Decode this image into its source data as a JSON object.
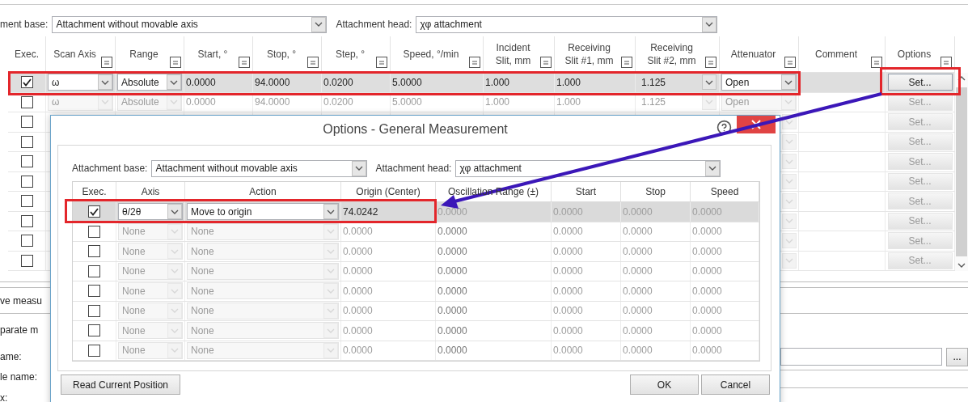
{
  "attachment": {
    "base_label": "ment base:",
    "base_value": "Attachment without movable axis",
    "head_label": "Attachment head:",
    "head_value": "χφ attachment"
  },
  "table": {
    "columns": [
      {
        "label": "Exec.",
        "filter": false
      },
      {
        "label": "Scan Axis",
        "filter": true
      },
      {
        "label": "Range",
        "filter": true
      },
      {
        "label": "Start, °",
        "filter": true
      },
      {
        "label": "Stop, °",
        "filter": true
      },
      {
        "label": "Step, °",
        "filter": true
      },
      {
        "label": "Speed, °/min",
        "filter": true
      },
      {
        "label": "Incident\nSlit, mm",
        "filter": true
      },
      {
        "label": "Receiving\nSlit #1, mm",
        "filter": true
      },
      {
        "label": "Receiving\nSlit #2, mm",
        "filter": true
      },
      {
        "label": "Attenuator",
        "filter": true
      },
      {
        "label": "Comment",
        "filter": true
      },
      {
        "label": "Options",
        "filter": true
      }
    ],
    "rows": [
      {
        "kind": "full",
        "checked": true,
        "selected": true,
        "enabled": true,
        "scan_axis": "ω",
        "range": "Absolute",
        "start": "0.0000",
        "stop": "94.0000",
        "step": "0.0200",
        "speed": "5.0000",
        "incident_slit": "1.000",
        "receiving_slit_1": "1.000",
        "receiving_slit_2": "1.125",
        "attenuator": "Open",
        "options": "Set..."
      },
      {
        "kind": "full",
        "checked": false,
        "selected": false,
        "enabled": false,
        "scan_axis": "ω",
        "range": "Absolute",
        "start": "0.0000",
        "stop": "94.0000",
        "step": "0.0200",
        "speed": "5.0000",
        "incident_slit": "1.000",
        "receiving_slit_1": "1.000",
        "receiving_slit_2": "1.125",
        "attenuator": "Open",
        "options": "Set..."
      },
      {
        "kind": "covered",
        "checked": false,
        "selected": false,
        "enabled": false,
        "options": "Set..."
      },
      {
        "kind": "covered",
        "checked": false,
        "selected": false,
        "enabled": false,
        "options": "Set..."
      },
      {
        "kind": "covered",
        "checked": false,
        "selected": false,
        "enabled": false,
        "options": "Set..."
      },
      {
        "kind": "covered",
        "checked": false,
        "selected": false,
        "enabled": false,
        "options": "Set..."
      },
      {
        "kind": "covered",
        "checked": false,
        "selected": false,
        "enabled": false,
        "options": "Set..."
      },
      {
        "kind": "covered",
        "checked": false,
        "selected": false,
        "enabled": false,
        "options": "Set..."
      },
      {
        "kind": "covered",
        "checked": false,
        "selected": false,
        "enabled": false,
        "options": "Set..."
      },
      {
        "kind": "covered",
        "checked": false,
        "selected": false,
        "enabled": false,
        "options": "Set..."
      }
    ]
  },
  "side_form": {
    "labels": [
      "ve measu",
      "parate m",
      "ame:",
      "le name:",
      "x:"
    ],
    "browse_button": "..."
  },
  "dialog": {
    "title": "Options - General Measurement",
    "attachment": {
      "base_label": "Attachment base:",
      "base_value": "Attachment without movable axis",
      "head_label": "Attachment head:",
      "head_value": "χφ attachment"
    },
    "columns": [
      "Exec.",
      "Axis",
      "Action",
      "Origin (Center)",
      "Oscillation Range (±)",
      "Start",
      "Stop",
      "Speed"
    ],
    "rows": [
      {
        "checked": true,
        "selected": true,
        "enabled": true,
        "axis": "θ/2θ",
        "action": "Move to origin",
        "origin": "74.0242",
        "oscillation_range": "0.0000",
        "start": "0.0000",
        "stop": "0.0000",
        "speed": "0.0000"
      },
      {
        "checked": false,
        "selected": false,
        "enabled": false,
        "axis": "None",
        "action": "None",
        "origin": "0.0000",
        "oscillation_range": "0.0000",
        "start": "0.0000",
        "stop": "0.0000",
        "speed": "0.0000"
      },
      {
        "checked": false,
        "selected": false,
        "enabled": false,
        "axis": "None",
        "action": "None",
        "origin": "0.0000",
        "oscillation_range": "0.0000",
        "start": "0.0000",
        "stop": "0.0000",
        "speed": "0.0000"
      },
      {
        "checked": false,
        "selected": false,
        "enabled": false,
        "axis": "None",
        "action": "None",
        "origin": "0.0000",
        "oscillation_range": "0.0000",
        "start": "0.0000",
        "stop": "0.0000",
        "speed": "0.0000"
      },
      {
        "checked": false,
        "selected": false,
        "enabled": false,
        "axis": "None",
        "action": "None",
        "origin": "0.0000",
        "oscillation_range": "0.0000",
        "start": "0.0000",
        "stop": "0.0000",
        "speed": "0.0000"
      },
      {
        "checked": false,
        "selected": false,
        "enabled": false,
        "axis": "None",
        "action": "None",
        "origin": "0.0000",
        "oscillation_range": "0.0000",
        "start": "0.0000",
        "stop": "0.0000",
        "speed": "0.0000"
      },
      {
        "checked": false,
        "selected": false,
        "enabled": false,
        "axis": "None",
        "action": "None",
        "origin": "0.0000",
        "oscillation_range": "0.0000",
        "start": "0.0000",
        "stop": "0.0000",
        "speed": "0.0000"
      },
      {
        "checked": false,
        "selected": false,
        "enabled": false,
        "axis": "None",
        "action": "None",
        "origin": "0.0000",
        "oscillation_range": "0.0000",
        "start": "0.0000",
        "stop": "0.0000",
        "speed": "0.0000"
      }
    ],
    "read_button": "Read Current Position",
    "buttons": [
      "OK",
      "Cancel"
    ]
  }
}
